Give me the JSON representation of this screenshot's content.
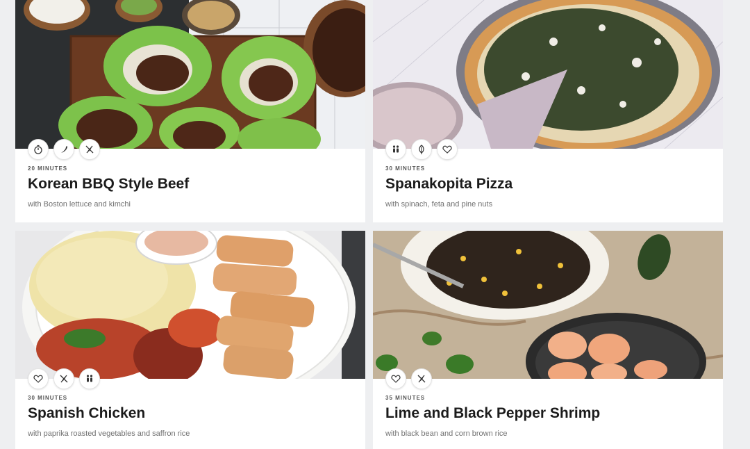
{
  "recipes": [
    {
      "time": "20 MINUTES",
      "title": "Korean BBQ Style Beef",
      "subtitle": "with Boston lettuce and kimchi",
      "tags": [
        "timer-icon",
        "spicy-pepper-icon",
        "no-gluten-icon"
      ]
    },
    {
      "time": "30 MINUTES",
      "title": "Spanakopita Pizza",
      "subtitle": "with spinach, feta and pine nuts",
      "tags": [
        "family-icon",
        "vegetarian-leaf-icon",
        "heart-icon"
      ]
    },
    {
      "time": "30 MINUTES",
      "title": "Spanish Chicken",
      "subtitle": "with paprika roasted vegetables and saffron rice",
      "tags": [
        "heart-icon",
        "no-gluten-icon",
        "family-icon"
      ]
    },
    {
      "time": "35 MINUTES",
      "title": "Lime and Black Pepper Shrimp",
      "subtitle": "with black bean and corn brown rice",
      "tags": [
        "heart-icon",
        "no-gluten-icon"
      ]
    }
  ]
}
